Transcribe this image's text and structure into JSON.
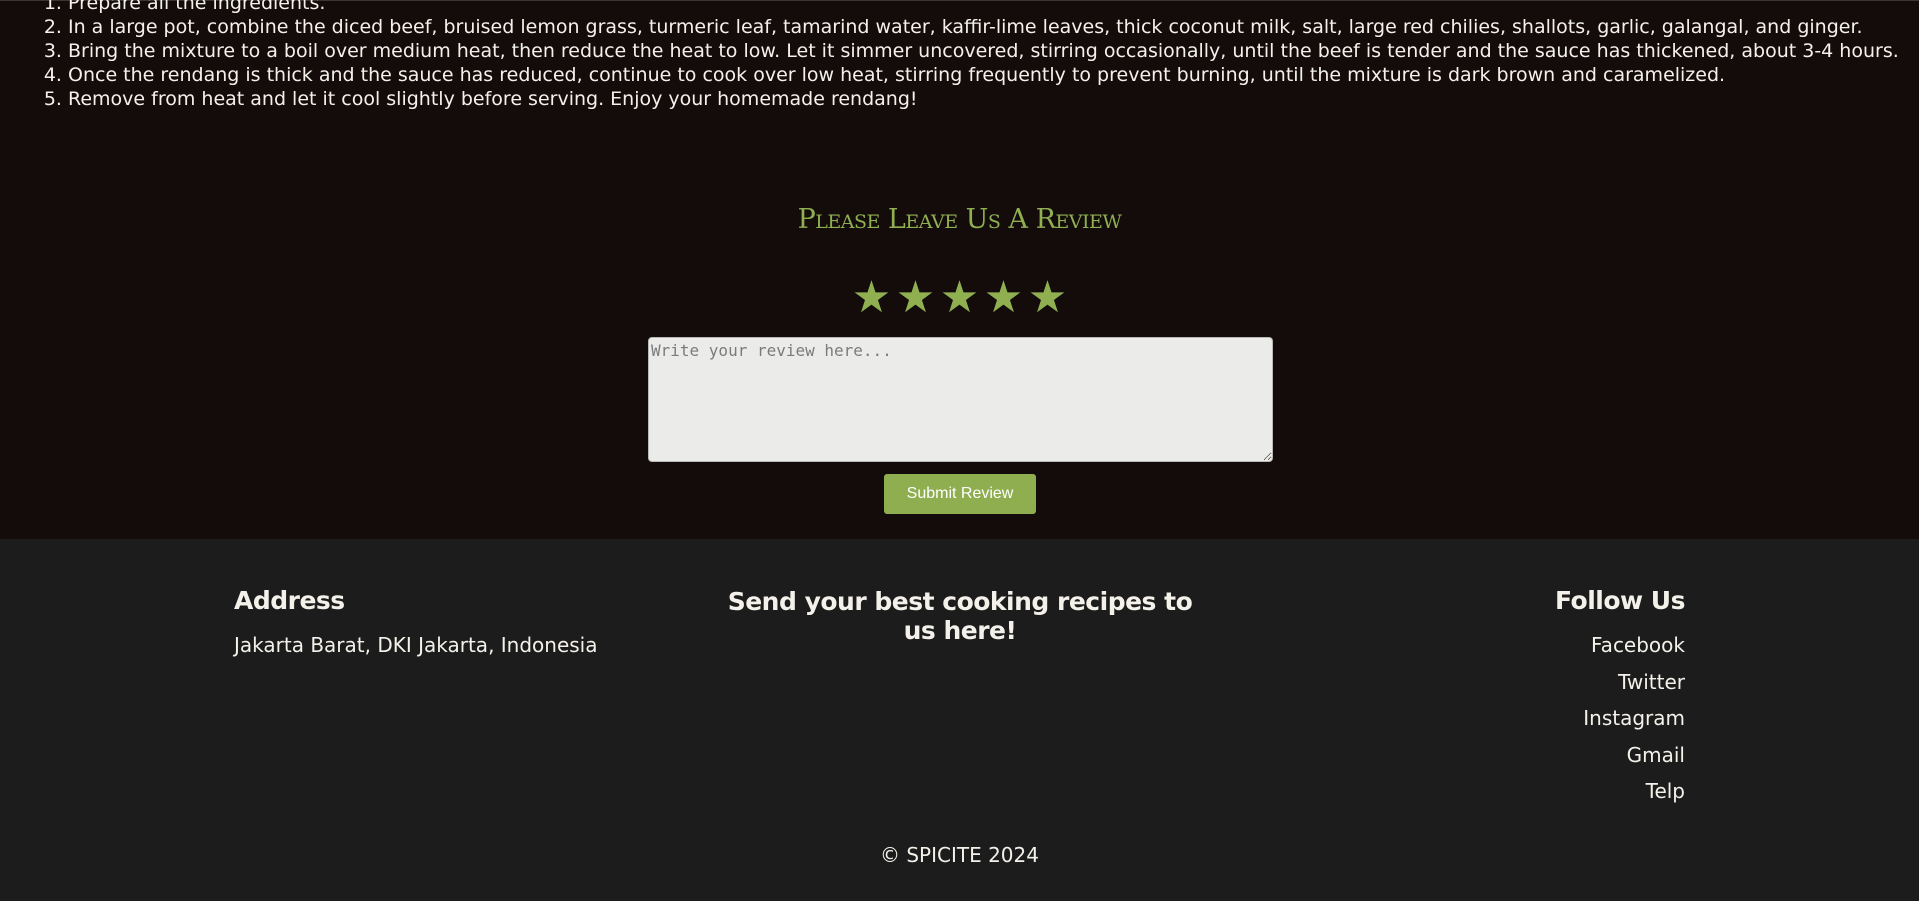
{
  "instructions": {
    "steps": [
      "Prepare all the ingredients.",
      "In a large pot, combine the diced beef, bruised lemon grass, turmeric leaf, tamarind water, kaffir-lime leaves, thick coconut milk, salt, large red chilies, shallots, garlic, galangal, and ginger.",
      "Bring the mixture to a boil over medium heat, then reduce the heat to low. Let it simmer uncovered, stirring occasionally, until the beef is tender and the sauce has thickened, about 3-4 hours.",
      "Once the rendang is thick and the sauce has reduced, continue to cook over low heat, stirring frequently to prevent burning, until the mixture is dark brown and caramelized.",
      "Remove from heat and let it cool slightly before serving. Enjoy your homemade rendang!"
    ]
  },
  "review": {
    "title": "Please Leave Us A Review",
    "star_glyph": "★",
    "star_count": 5,
    "placeholder": "Write your review here...",
    "submit_label": "Submit Review",
    "accent_color": "#8faf51"
  },
  "footer": {
    "address_heading": "Address",
    "address_text": "Jakarta Barat, DKI Jakarta, Indonesia",
    "send_heading": "Send your best cooking recipes to us here!",
    "follow_heading": "Follow Us",
    "social_links": [
      "Facebook",
      "Twitter",
      "Instagram",
      "Gmail",
      "Telp"
    ],
    "copyright": "© SPICITE 2024"
  }
}
